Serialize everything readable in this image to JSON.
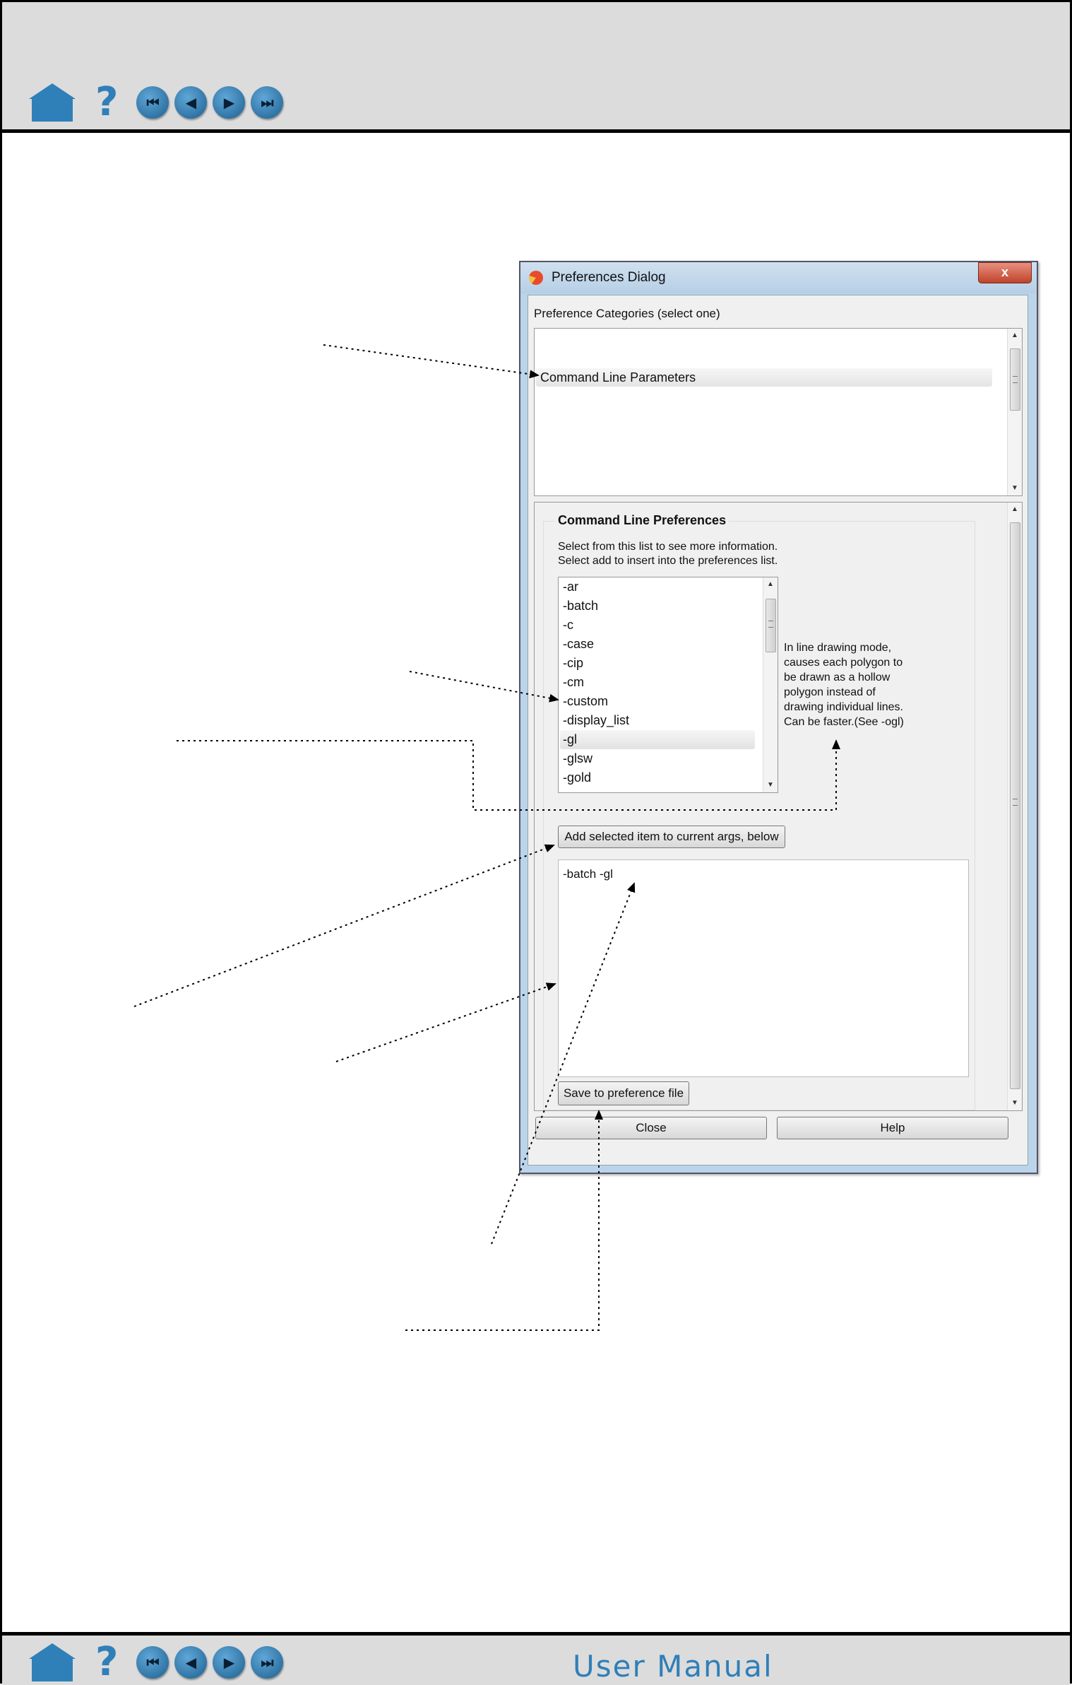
{
  "header": {
    "nav_icons": [
      "home-icon",
      "help-icon",
      "first-page-icon",
      "previous-page-icon",
      "next-page-icon",
      "last-page-icon"
    ],
    "help_glyph": "?"
  },
  "footer": {
    "manual_title": "User Manual"
  },
  "dialog": {
    "title": "Preferences Dialog",
    "close_glyph": "x",
    "categories_label": "Preference Categories (select one)",
    "categories": [
      "Command Line Parameters"
    ],
    "selected_category": "Command Line Parameters",
    "group_title": "Command Line Preferences",
    "hint_line1": "Select from this list to see more information.",
    "hint_line2": "Select add to insert into the preferences list.",
    "options": [
      "-ar",
      "-batch",
      "-c",
      "-case",
      "-cip",
      "-cm",
      "-custom",
      "-display_list",
      "-gl",
      "-glsw",
      "-gold"
    ],
    "selected_option": "-gl",
    "description_lines": [
      "In line drawing mode,",
      "causes each polygon to",
      "be drawn as a hollow",
      "polygon instead of",
      "drawing individual lines.",
      "Can be faster.(See -ogl)"
    ],
    "add_button": "Add selected item to current args, below",
    "current_args": "-batch -gl",
    "save_button": "Save to preference file",
    "close_button": "Close",
    "help_button": "Help"
  },
  "colors": {
    "nav_blue": "#2f7fb8",
    "bar_gray": "#dcdcdc",
    "dialog_frame": "#bcd4ea"
  }
}
